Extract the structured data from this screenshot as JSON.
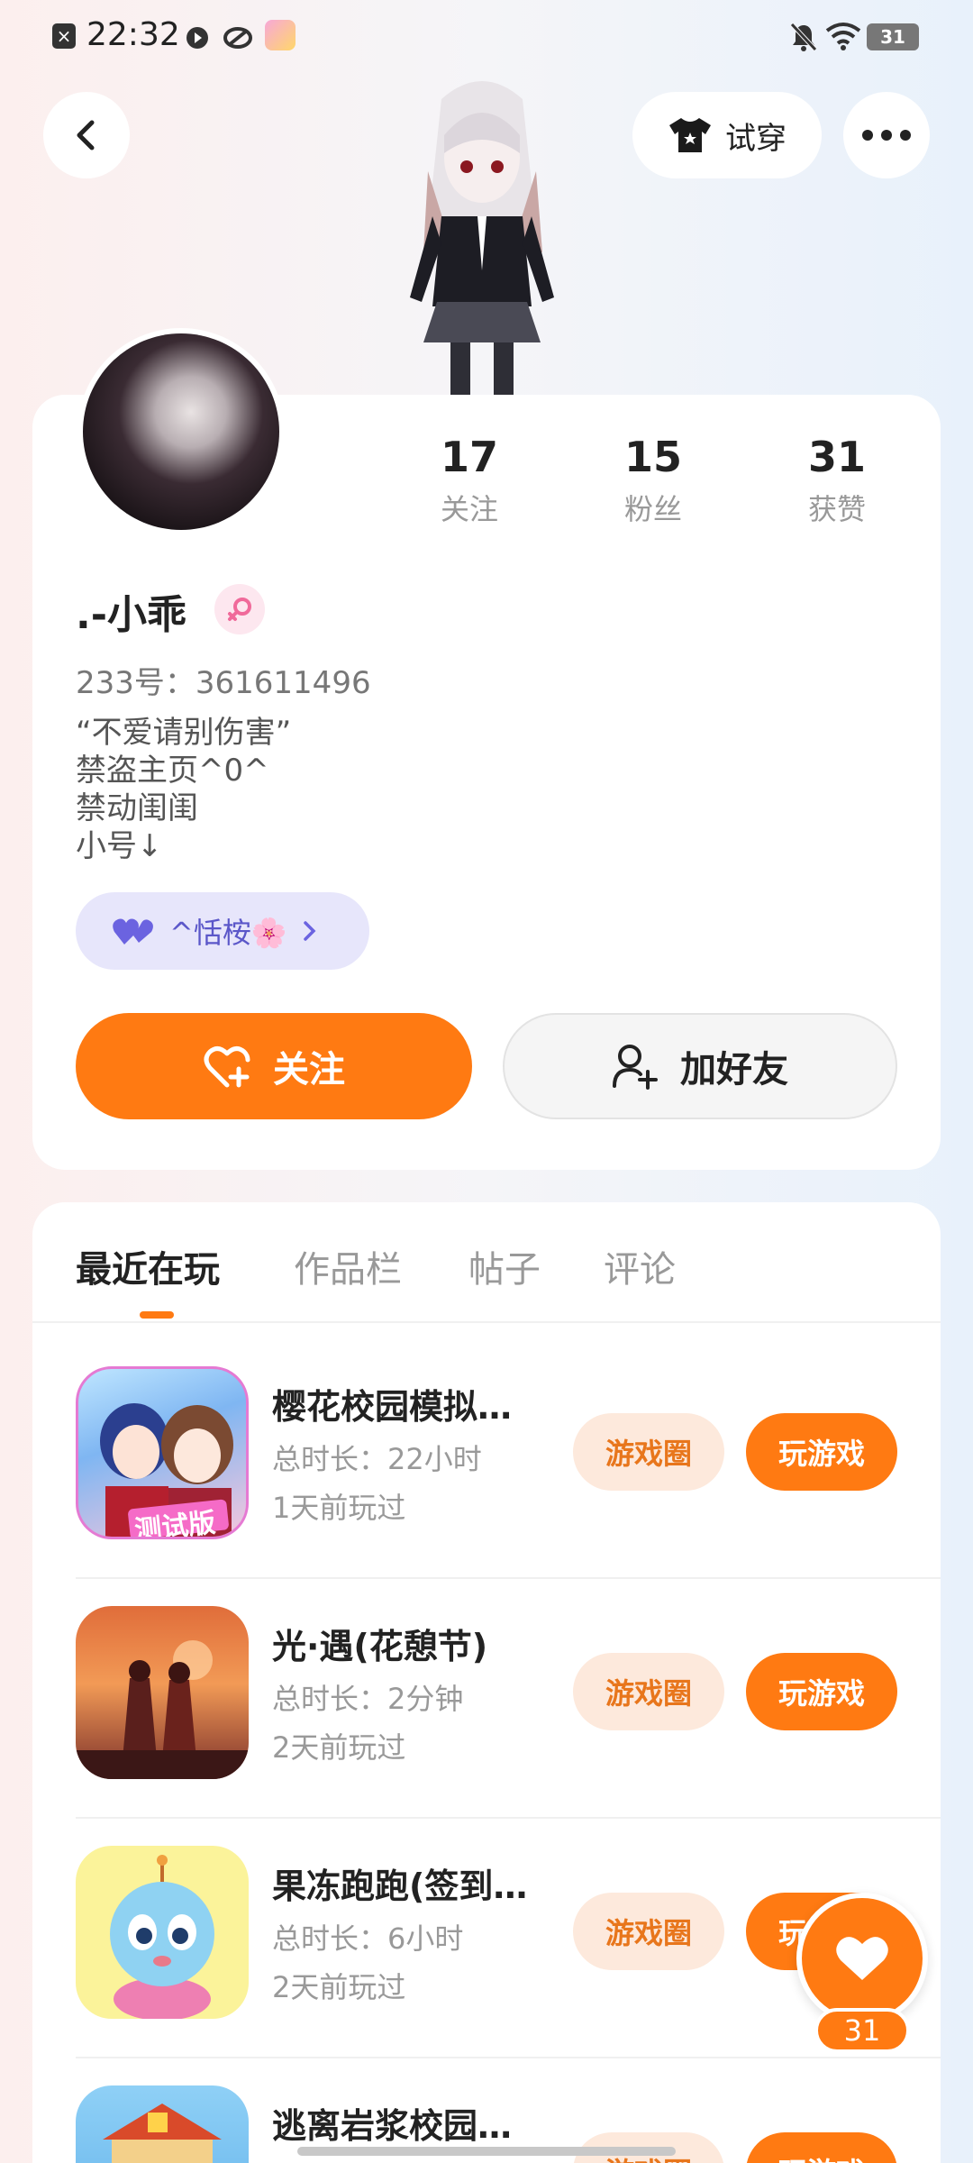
{
  "status_bar": {
    "time": "22:32",
    "battery": "31"
  },
  "header": {
    "tryon_label": "试穿"
  },
  "profile": {
    "stats": [
      {
        "num": "17",
        "label": "关注"
      },
      {
        "num": "15",
        "label": "粉丝"
      },
      {
        "num": "31",
        "label": "获赞"
      }
    ],
    "username": ".-小乖",
    "uid": "233号：361611496",
    "bio": [
      "“不爱请别伤害”",
      "禁盗主页^0^",
      "禁动闺闺",
      "小号↓"
    ],
    "guild": "^恬桉🌸",
    "follow_label": "关注",
    "add_friend_label": "加好友"
  },
  "tabs": [
    "最近在玩",
    "作品栏",
    "帖子",
    "评论"
  ],
  "games": [
    {
      "name": "樱花校园模拟…",
      "duration": "总时长：22小时",
      "last_played": "1天前玩过",
      "circle_label": "游戏圈",
      "play_label": "玩游戏"
    },
    {
      "name": "光·遇(花憩节)",
      "duration": "总时长：2分钟",
      "last_played": "2天前玩过",
      "circle_label": "游戏圈",
      "play_label": "玩游戏"
    },
    {
      "name": "果冻跑跑(签到…",
      "duration": "总时长：6小时",
      "last_played": "2天前玩过",
      "circle_label": "游戏圈",
      "play_label": "玩游戏"
    },
    {
      "name": "逃离岩浆校园…",
      "duration": "",
      "last_played": "",
      "circle_label": "游戏圈",
      "play_label": "玩游戏"
    }
  ],
  "game_icon_badge": "测试版",
  "like_fab": {
    "count": "31"
  },
  "colors": {
    "accent": "#ff7a12",
    "accent_light": "#fde9dc",
    "guild_bg": "#e7e6fb"
  }
}
